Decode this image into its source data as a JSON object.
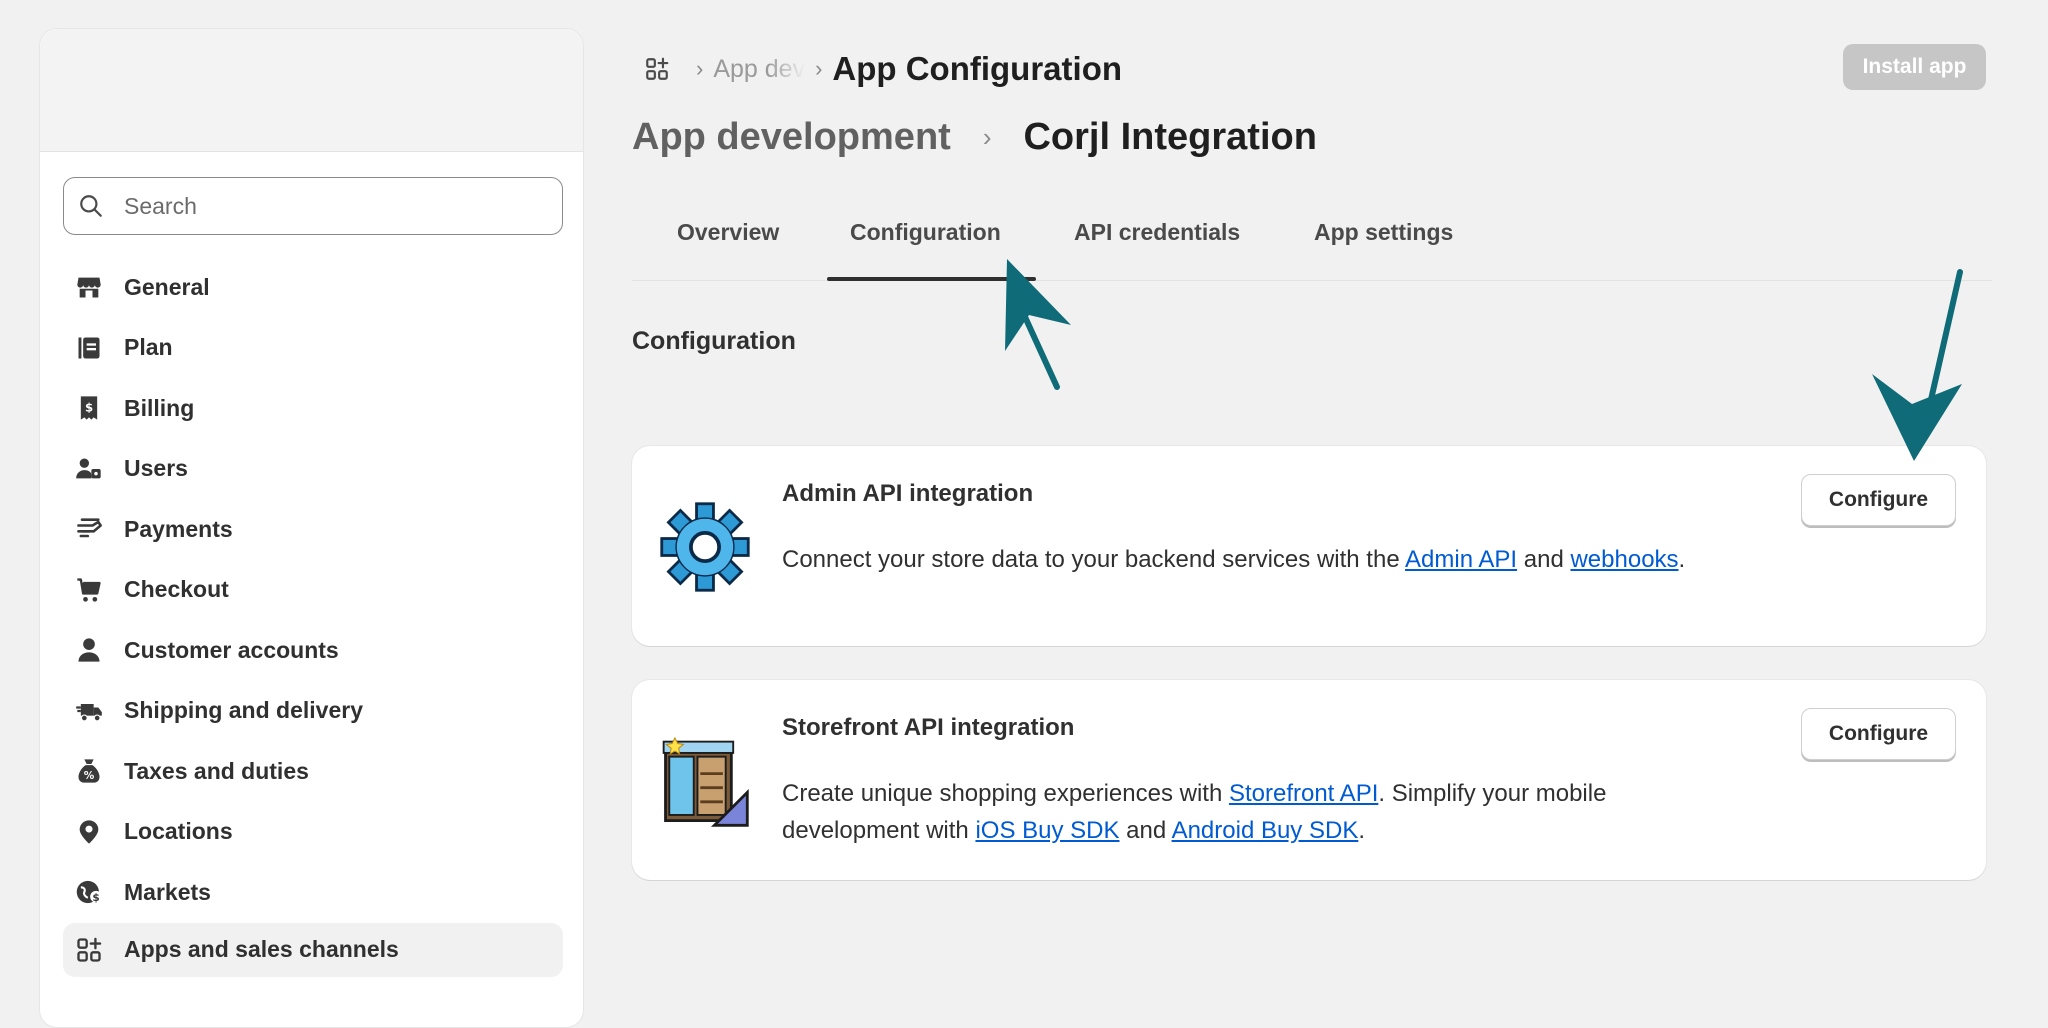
{
  "sidebar": {
    "search_placeholder": "Search",
    "items": [
      {
        "label": "General",
        "icon": "store-icon"
      },
      {
        "label": "Plan",
        "icon": "plan-icon"
      },
      {
        "label": "Billing",
        "icon": "receipt-icon"
      },
      {
        "label": "Users",
        "icon": "users-icon"
      },
      {
        "label": "Payments",
        "icon": "payments-icon"
      },
      {
        "label": "Checkout",
        "icon": "cart-icon"
      },
      {
        "label": "Customer accounts",
        "icon": "person-icon"
      },
      {
        "label": "Shipping and delivery",
        "icon": "truck-icon"
      },
      {
        "label": "Taxes and duties",
        "icon": "tax-bag-icon"
      },
      {
        "label": "Locations",
        "icon": "location-pin-icon"
      },
      {
        "label": "Markets",
        "icon": "globe-icon"
      },
      {
        "label": "Apps and sales channels",
        "icon": "apps-icon",
        "active": true
      }
    ]
  },
  "header": {
    "breadcrumb_parent": "App dev",
    "breadcrumb_current": "App Configuration",
    "install_button": "Install app"
  },
  "page": {
    "title_parent": "App development",
    "title_name": "Corjl Integration"
  },
  "tabs": [
    {
      "label": "Overview"
    },
    {
      "label": "Configuration",
      "active": true
    },
    {
      "label": "API credentials"
    },
    {
      "label": "App settings"
    }
  ],
  "section": {
    "label": "Configuration"
  },
  "cards": [
    {
      "title": "Admin API integration",
      "desc_1": "Connect your store data to your backend services with the ",
      "link_1": "Admin API",
      "desc_2": " and ",
      "link_2": "webhooks",
      "desc_3": ".",
      "button": "Configure",
      "icon": "gear-icon"
    },
    {
      "title": "Storefront API integration",
      "desc_1": "Create unique shopping experiences with ",
      "link_1": "Storefront API",
      "desc_2": ". Simplify your mobile development with ",
      "link_2": "iOS Buy SDK",
      "desc_3": " and ",
      "link_3": "Android Buy SDK",
      "desc_4": ".",
      "button": "Configure",
      "icon": "storefront-icon"
    }
  ],
  "colors": {
    "annotation_arrow": "#0f6b77",
    "link": "#005bd3"
  }
}
